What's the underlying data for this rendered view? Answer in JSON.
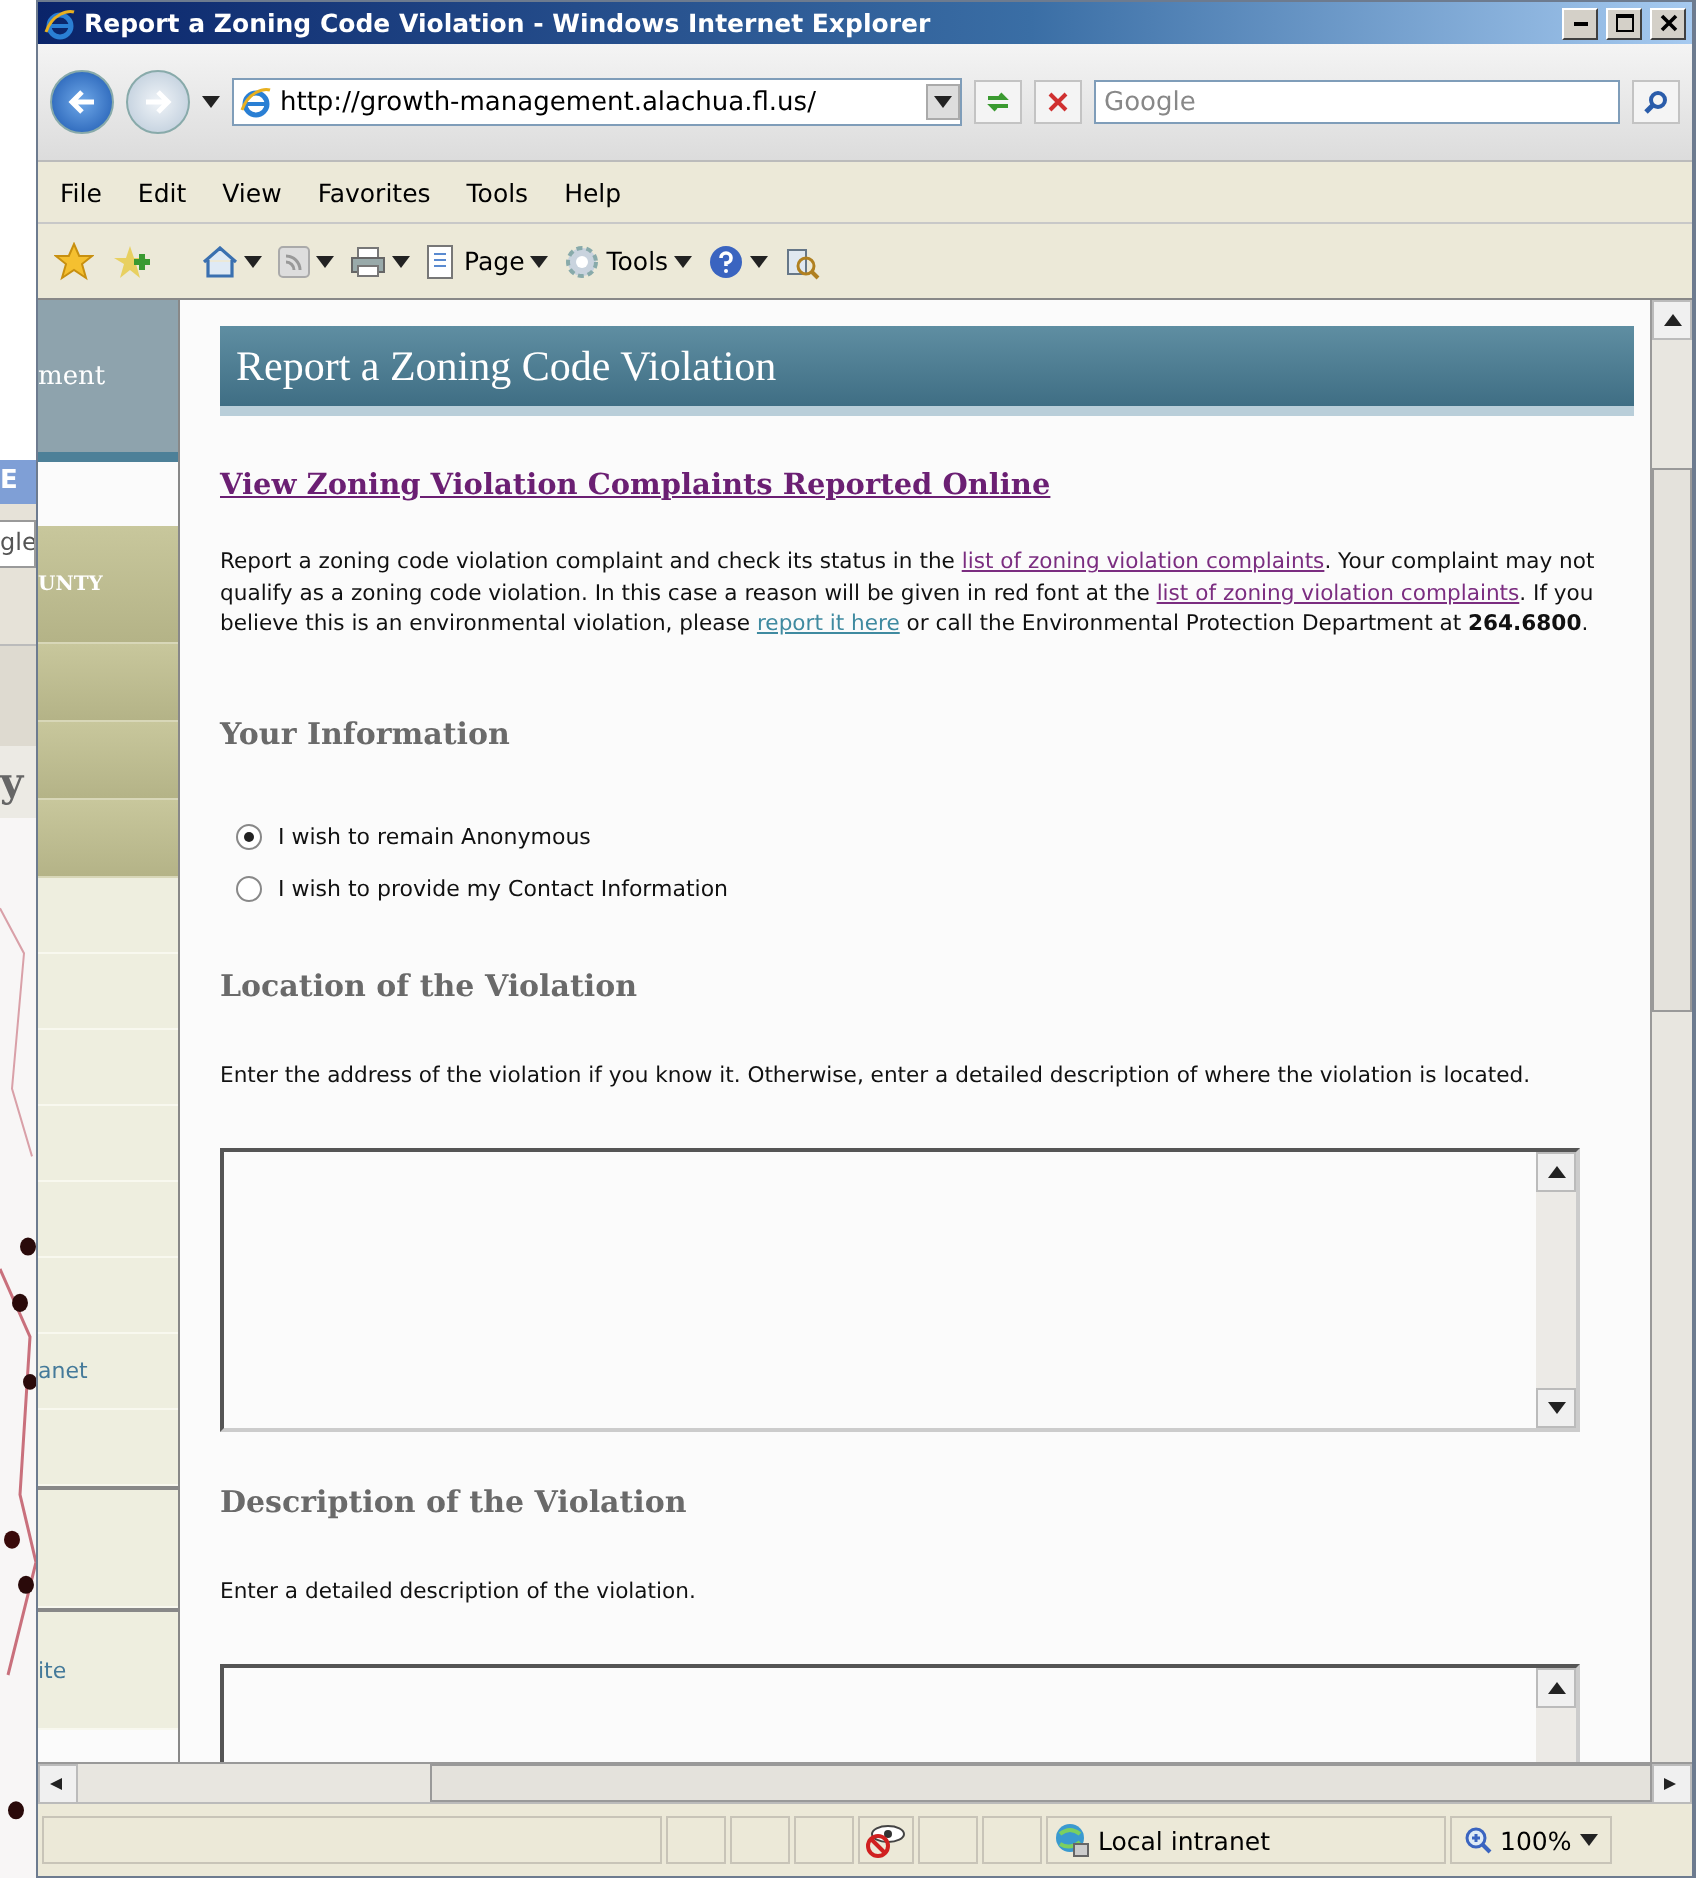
{
  "background_window": {
    "title": "E",
    "search": "gle",
    "heading": "y"
  },
  "window": {
    "title": "Report a Zoning Code Violation - Windows Internet Explorer"
  },
  "address_bar": {
    "value": "http://growth-management.alachua.fl.us/"
  },
  "search": {
    "placeholder": "Google"
  },
  "menu": [
    "File",
    "Edit",
    "View",
    "Favorites",
    "Tools",
    "Help"
  ],
  "command_bar": {
    "page": "Page",
    "tools": "Tools"
  },
  "site_nav": [
    {
      "kind": "header",
      "label": "ment"
    },
    {
      "kind": "section",
      "label": "UNTY"
    },
    {
      "kind": "section"
    },
    {
      "kind": "section"
    },
    {
      "kind": "section"
    },
    {
      "kind": "link"
    },
    {
      "kind": "link"
    },
    {
      "kind": "link"
    },
    {
      "kind": "link"
    },
    {
      "kind": "link"
    },
    {
      "kind": "link"
    },
    {
      "kind": "link",
      "label": "anet"
    },
    {
      "kind": "link"
    },
    {
      "kind": "group_start"
    },
    {
      "kind": "group_start",
      "label": "ite"
    }
  ],
  "page": {
    "heading": "Report a Zoning Code Violation",
    "view_link": "View Zoning Violation Complaints Reported Online",
    "intro": [
      {
        "kind": "text",
        "text": "Report a zoning code violation complaint and check its status in the "
      },
      {
        "kind": "link",
        "text": "list of zoning violation complaints",
        "visited": true
      },
      {
        "kind": "text",
        "text": ". Your complaint may not qualify as a zoning code violation. In this case a reason will be given in red font at the "
      },
      {
        "kind": "link",
        "text": "list of zoning violation complaints",
        "visited": true
      },
      {
        "kind": "text",
        "text": ". If you believe this is an environmental violation, please "
      },
      {
        "kind": "link",
        "text": "report it here",
        "visited": false
      },
      {
        "kind": "text",
        "text": " or call the Environmental Protection Department at "
      },
      {
        "kind": "bold",
        "text": "264.6800"
      },
      {
        "kind": "text",
        "text": "."
      }
    ],
    "sections": [
      {
        "kind": "choice",
        "title": "Your Information",
        "options": [
          {
            "label": "I wish to remain Anonymous",
            "selected": true
          },
          {
            "label": "I wish to provide my Contact Information",
            "selected": false
          }
        ]
      },
      {
        "kind": "textarea",
        "title": "Location of the Violation",
        "instructions": "Enter the address of the violation if you know it. Otherwise, enter a detailed description of where the violation is located."
      },
      {
        "kind": "textarea",
        "title": "Description of the Violation",
        "instructions": "Enter a detailed description of the violation."
      }
    ]
  },
  "status_bar": {
    "zone": "Local intranet",
    "zoom": "100%"
  }
}
